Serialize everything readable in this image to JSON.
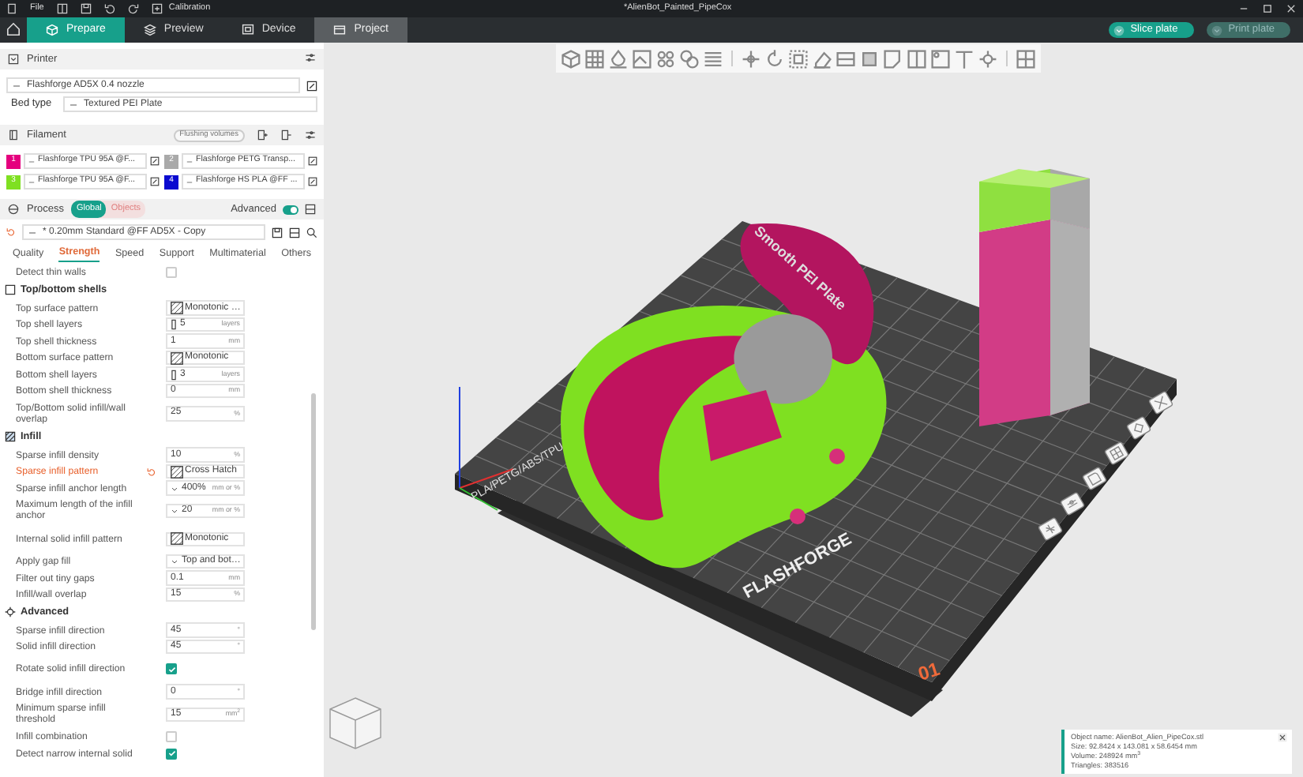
{
  "title_bar": {
    "menu": "File",
    "calibration": "Calibration",
    "document_title": "*AlienBot_Painted_PipeCox"
  },
  "main_tabs": [
    {
      "label": "Prepare",
      "selected": true,
      "hovered": false
    },
    {
      "label": "Preview",
      "selected": false,
      "hovered": false
    },
    {
      "label": "Device",
      "selected": false,
      "hovered": false
    },
    {
      "label": "Project",
      "selected": false,
      "hovered": true
    }
  ],
  "actions": [
    {
      "label": "Slice plate",
      "disabled": false
    },
    {
      "label": "Print plate",
      "disabled": true
    }
  ],
  "printer": {
    "title": "Printer",
    "preset": "Flashforge AD5X 0.4 nozzle",
    "bed_type_label": "Bed type",
    "bed_type": "Textured PEI Plate"
  },
  "filament": {
    "title": "Filament",
    "flushing_button": "Flushing volumes",
    "items": [
      {
        "number": "1",
        "name": "Flashforge TPU 95A @F...",
        "color": "#e5007e"
      },
      {
        "number": "2",
        "name": "Flashforge PETG Transp...",
        "color": "#a9a9a9"
      },
      {
        "number": "3",
        "name": "Flashforge TPU 95A @F...",
        "color": "#7fe021"
      },
      {
        "number": "4",
        "name": "Flashforge HS PLA @FF ...",
        "color": "#0a0ad0"
      }
    ]
  },
  "process": {
    "title": "Process",
    "scope": [
      {
        "label": "Global",
        "selected": true
      },
      {
        "label": "Objects",
        "selected": false
      }
    ],
    "advanced_label": "Advanced",
    "advanced_on": true,
    "preset": "* 0.20mm Standard @FF AD5X - Copy",
    "tabs": [
      {
        "label": "Quality",
        "selected": false
      },
      {
        "label": "Strength",
        "selected": true
      },
      {
        "label": "Speed",
        "selected": false
      },
      {
        "label": "Support",
        "selected": false
      },
      {
        "label": "Multimaterial",
        "selected": false
      },
      {
        "label": "Others",
        "selected": false
      }
    ],
    "settings": [
      {
        "kind": "check",
        "label": "Detect thin walls",
        "checked": false,
        "modified": false
      },
      {
        "kind": "group",
        "label": "Top/bottom shells"
      },
      {
        "kind": "pattern",
        "label": "Top surface pattern",
        "value": "Monotonic …",
        "modified": false
      },
      {
        "kind": "spin",
        "label": "Top shell layers",
        "value": "5",
        "unit": "layers",
        "modified": false
      },
      {
        "kind": "number",
        "label": "Top shell thickness",
        "value": "1",
        "unit": "mm",
        "modified": false
      },
      {
        "kind": "pattern",
        "label": "Bottom surface pattern",
        "value": "Monotonic",
        "modified": false
      },
      {
        "kind": "spin",
        "label": "Bottom shell layers",
        "value": "3",
        "unit": "layers",
        "modified": false
      },
      {
        "kind": "number",
        "label": "Bottom shell thickness",
        "value": "0",
        "unit": "mm",
        "modified": false
      },
      {
        "kind": "number",
        "label": "Top/Bottom solid infill/wall overlap",
        "value": "25",
        "unit": "%",
        "modified": false
      },
      {
        "kind": "group",
        "label": "Infill"
      },
      {
        "kind": "number",
        "label": "Sparse infill density",
        "value": "10",
        "unit": "%",
        "modified": false
      },
      {
        "kind": "pattern",
        "label": "Sparse infill pattern",
        "value": "Cross Hatch",
        "modified": true
      },
      {
        "kind": "combo",
        "label": "Sparse infill anchor length",
        "value": "400%",
        "unit": "mm or %",
        "modified": false
      },
      {
        "kind": "combo",
        "label": "Maximum length of the infill anchor",
        "value": "20",
        "unit": "mm or %",
        "modified": false
      },
      {
        "kind": "pattern",
        "label": "Internal solid infill pattern",
        "value": "Monotonic",
        "modified": false
      },
      {
        "kind": "combo",
        "label": "Apply gap fill",
        "value": "Top and bot…",
        "modified": false
      },
      {
        "kind": "number",
        "label": "Filter out tiny gaps",
        "value": "0.1",
        "unit": "mm",
        "modified": false
      },
      {
        "kind": "number",
        "label": "Infill/wall overlap",
        "value": "15",
        "unit": "%",
        "modified": false
      },
      {
        "kind": "group",
        "label": "Advanced"
      },
      {
        "kind": "number",
        "label": "Sparse infill direction",
        "value": "45",
        "unit": "°",
        "modified": false
      },
      {
        "kind": "number",
        "label": "Solid infill direction",
        "value": "45",
        "unit": "°",
        "modified": false
      },
      {
        "kind": "check",
        "label": "Rotate solid infill direction",
        "checked": true,
        "modified": false
      },
      {
        "kind": "number",
        "label": "Bridge infill direction",
        "value": "0",
        "unit": "°",
        "modified": false
      },
      {
        "kind": "number",
        "label": "Minimum sparse infill threshold",
        "value": "15",
        "unit": "mm$^{2}$",
        "modified": false
      },
      {
        "kind": "check",
        "label": "Infill combination",
        "checked": false,
        "modified": false
      },
      {
        "kind": "check",
        "label": "Detect narrow internal solid",
        "checked": true,
        "modified": false
      }
    ]
  },
  "viewport": {
    "plate_labels": [
      {
        "text": "Smooth PEI Plate"
      },
      {
        "text": "PLA/PETG/ABS/TPU"
      },
      {
        "text": "FLASHFORGE"
      },
      {
        "text": "01"
      }
    ],
    "info": {
      "lines": [
        "Object name: AlienBot_Alien_PipeCox.stl",
        "Size: 92.8424 x 143.081 x 58.6454 mm",
        "Volume: 248924 mm$^{3}$",
        "Triangles: 383516"
      ]
    }
  }
}
